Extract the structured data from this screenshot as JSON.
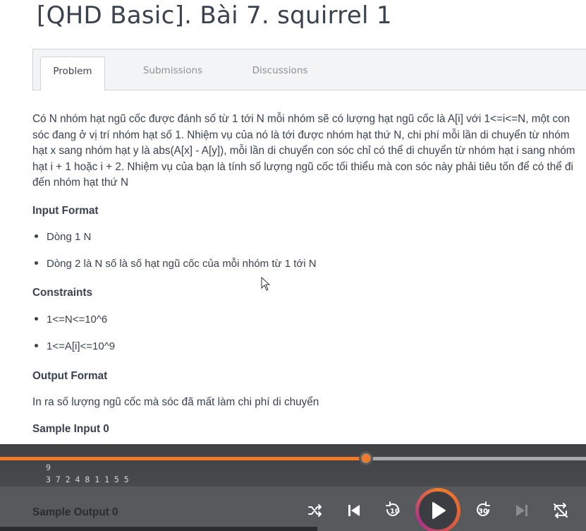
{
  "page": {
    "title": "[QHD Basic]. Bài 7. squirrel 1"
  },
  "tabs": [
    {
      "label": "Problem",
      "active": true
    },
    {
      "label": "Submissions",
      "active": false
    },
    {
      "label": "Discussions",
      "active": false
    }
  ],
  "problem": {
    "statement": "Có N nhóm hạt ngũ cốc được đánh số từ 1 tới N mỗi nhóm sẽ có lượng hạt ngũ cốc là A[i] với 1<=i<=N, một con sóc đang ở vị trí nhóm hạt số 1. Nhiệm vụ của nó là tới được nhóm hạt thứ N, chi phí mỗi lần di chuyển từ nhóm hạt x sang nhóm hạt y là abs(A[x] - A[y]), mỗi lần di chuyển con sóc chỉ có thể di chuyển từ nhóm hạt i sang nhóm hạt i + 1 hoặc i + 2. Nhiệm vụ của bạn là tính số lượng ngũ cốc tối thiểu mà con sóc này phải tiêu tốn để có thể đi đến nhóm hạt thứ N",
    "input_format_title": "Input Format",
    "input_format_items": [
      "Dòng 1 N",
      "Dòng 2 là N số là số hạt ngũ cốc của mỗi nhóm từ 1 tới N"
    ],
    "constraints_title": "Constraints",
    "constraints_items": [
      "1<=N<=10^6",
      "1<=A[i]<=10^9"
    ],
    "output_format_title": "Output Format",
    "output_format_text": "In ra số lượng ngũ cốc mà sóc đã mất làm chi phí di chuyển",
    "sample_input_title": "Sample Input 0",
    "sample_input_lines": [
      "9",
      "3 7 2 4 8 1 1 5 5"
    ],
    "sample_output_title": "Sample Output 0"
  },
  "player": {
    "progress": 0.624,
    "accent_color": "#f07a2a",
    "controls": [
      {
        "name": "shuffle-icon"
      },
      {
        "name": "skip-previous-icon"
      },
      {
        "name": "rewind-10-icon",
        "label": "10"
      },
      {
        "name": "play-icon"
      },
      {
        "name": "forward-30-icon",
        "label": "30"
      },
      {
        "name": "skip-next-icon"
      },
      {
        "name": "repeat-off-icon"
      }
    ]
  }
}
